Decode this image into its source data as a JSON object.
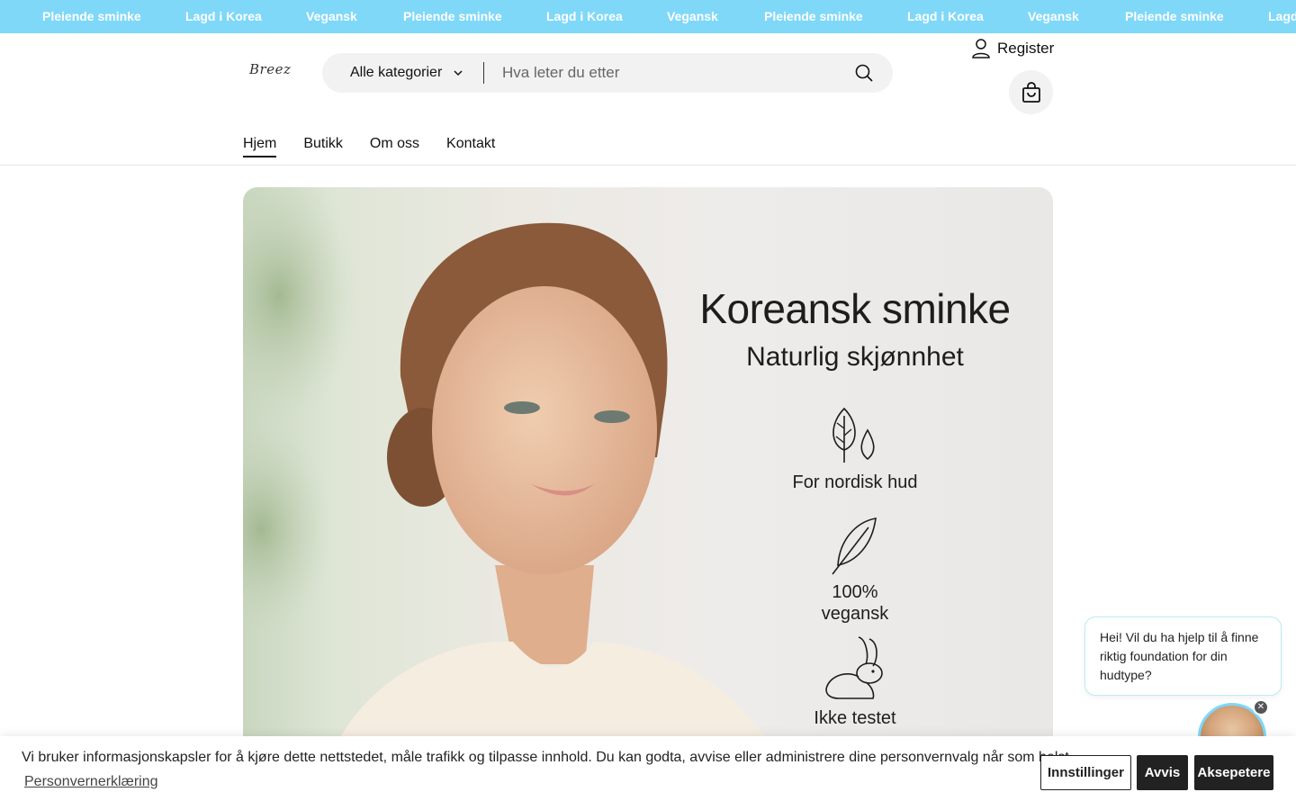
{
  "announcement": {
    "items": [
      "Pleiende sminke",
      "Lagd i Korea",
      "Vegansk",
      "Pleiende sminke",
      "Lagd i Korea",
      "Vegansk",
      "Pleiende sminke",
      "Lagd i Korea",
      "Vegansk",
      "Pleiende sminke",
      "Lagd i Korea"
    ],
    "background": "#7fd8f8"
  },
  "header": {
    "logo_text": "Breez",
    "search": {
      "category_label": "Alle kategorier",
      "placeholder": "Hva leter du etter",
      "value": ""
    },
    "register_label": "Register",
    "cart_icon": "shopping-bag-icon"
  },
  "nav": {
    "items": [
      {
        "label": "Hjem",
        "active": true
      },
      {
        "label": "Butikk",
        "active": false
      },
      {
        "label": "Om oss",
        "active": false
      },
      {
        "label": "Kontakt",
        "active": false
      }
    ]
  },
  "hero": {
    "title": "Koreansk sminke",
    "subtitle": "Naturlig skjønnhet",
    "features": [
      {
        "icon": "tree-drop-icon",
        "label": "For nordisk hud"
      },
      {
        "icon": "feather-icon",
        "label": "100%\nvegansk"
      },
      {
        "icon": "rabbit-icon",
        "label": "Ikke testet"
      }
    ]
  },
  "chat": {
    "message": "Hei! Vil du ha hjelp til å finne riktig foundation for din hudtype?",
    "close_icon": "close-icon"
  },
  "cookie": {
    "text": "Vi bruker informasjonskapsler for å kjøre dette nettstedet, måle trafikk og tilpasse innhold. Du kan godta, avvise eller administrere dine personvernvalg når som helst.",
    "link": "Personvernerklæring",
    "settings_label": "Innstillinger",
    "reject_label": "Avvis",
    "accept_label": "Aksepetere"
  }
}
